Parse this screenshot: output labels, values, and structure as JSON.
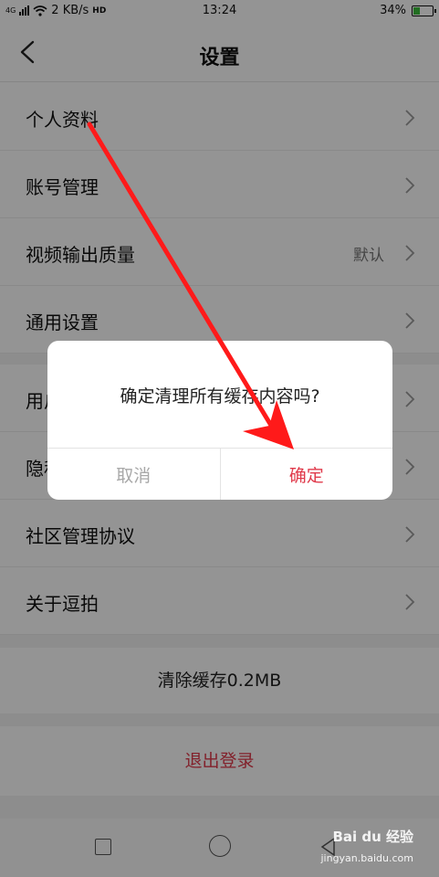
{
  "status_bar": {
    "network": "4G",
    "speed": "2 KB/s",
    "hd_badge": "HD",
    "time": "13:24",
    "battery": "34%",
    "battery_level": 0.34
  },
  "navbar": {
    "title": "设置",
    "back_icon": "chevron-left-icon"
  },
  "settings_group_1": [
    {
      "label": "个人资料",
      "value": ""
    },
    {
      "label": "账号管理",
      "value": ""
    },
    {
      "label": "视频输出质量",
      "value": "默认"
    },
    {
      "label": "通用设置",
      "value": ""
    }
  ],
  "settings_group_2": [
    {
      "label": "用户协议"
    },
    {
      "label": "隐私政策"
    },
    {
      "label": "社区管理协议"
    },
    {
      "label": "关于逗拍"
    }
  ],
  "clear_cache": "清除缓存0.2MB",
  "logout": "退出登录",
  "dialog": {
    "message": "确定清理所有缓存内容吗?",
    "cancel": "取消",
    "confirm": "确定"
  },
  "colors": {
    "accent_red": "#e03a4b",
    "annotation_arrow": "#ff1a1a",
    "battery_green": "#3bbd3b"
  },
  "watermark": {
    "brand": "Bai du 经验",
    "url": "jingyan.baidu.com"
  }
}
